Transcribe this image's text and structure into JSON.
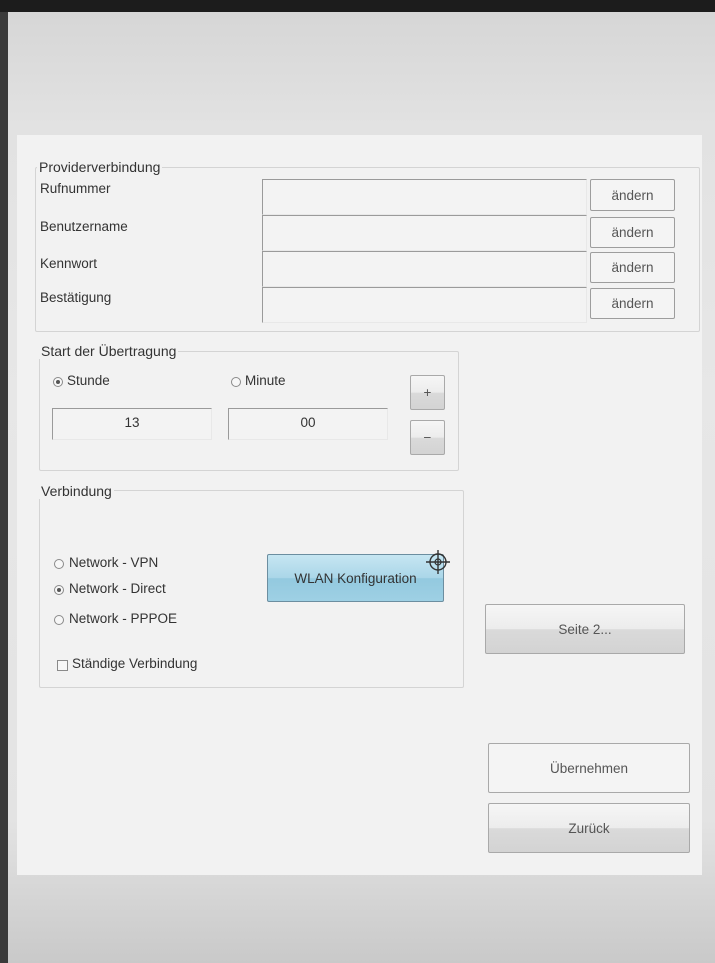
{
  "provider": {
    "title": "Providerverbindung",
    "rows": [
      {
        "label": "Rufnummer",
        "value": "",
        "button": "ändern"
      },
      {
        "label": "Benutzername",
        "value": "",
        "button": "ändern"
      },
      {
        "label": "Kennwort",
        "value": "",
        "button": "ändern"
      },
      {
        "label": "Bestätigung",
        "value": "",
        "button": "ändern"
      }
    ]
  },
  "transfer": {
    "title": "Start der Übertragung",
    "hour_label": "Stunde",
    "minute_label": "Minute",
    "hour_value": "13",
    "minute_value": "00",
    "selected": "Stunde",
    "plus": "+",
    "minus": "−"
  },
  "connection": {
    "title": "Verbindung",
    "options": [
      "Network - VPN",
      "Network - Direct",
      "Network - PPPOE"
    ],
    "selected": "Network - Direct",
    "permanent_label": "Ständige Verbindung",
    "permanent_checked": false,
    "wlan_button": "WLAN Konfiguration"
  },
  "buttons": {
    "page2": "Seite 2...",
    "apply": "Übernehmen",
    "back": "Zurück"
  },
  "icons": {
    "crosshair": "crosshair-icon"
  }
}
